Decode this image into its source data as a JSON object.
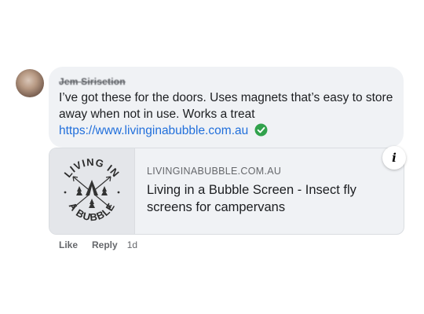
{
  "comment": {
    "author": "Jem Sirisetion",
    "text": "I’ve got these for the doors. Uses magnets that’s easy to store away when not in use. Works a treat",
    "link": "https://www.livinginabubble.com.au"
  },
  "preview": {
    "domain": "LIVINGINABUBBLE.COM.AU",
    "title": "Living in a Bubble Screen - Insect fly screens for campervans",
    "logo_text_top": "LIVING IN",
    "logo_text_bottom": "A BUBBLE",
    "info_label": "i"
  },
  "actions": {
    "like": "Like",
    "reply": "Reply",
    "time": "1d"
  },
  "colors": {
    "link": "#216fdb",
    "verified": "#31a24c",
    "bubble": "#f0f2f5"
  },
  "icons": {
    "verified": "check-circle-icon",
    "info": "info-icon"
  }
}
